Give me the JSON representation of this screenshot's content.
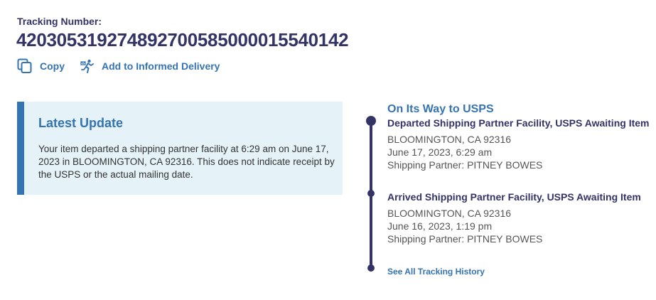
{
  "tracking": {
    "label": "Tracking Number:",
    "number": "420305319274892700585000015540142"
  },
  "actions": {
    "copy_label": "Copy",
    "informed_delivery_label": "Add to Informed Delivery"
  },
  "latest_update": {
    "title": "Latest Update",
    "text": "Your item departed a shipping partner facility at 6:29 am on June 17, 2023 in BLOOMINGTON, CA 92316. This does not indicate receipt by the USPS or the actual mailing date."
  },
  "timeline": {
    "status": "On Its Way to USPS",
    "events": [
      {
        "title": "Departed Shipping Partner Facility, USPS Awaiting Item",
        "location": "BLOOMINGTON, CA 92316",
        "datetime": "June 17, 2023, 6:29 am",
        "partner": "Shipping Partner: PITNEY BOWES"
      },
      {
        "title": "Arrived Shipping Partner Facility, USPS Awaiting Item",
        "location": "BLOOMINGTON, CA 92316",
        "datetime": "June 16, 2023, 1:19 pm",
        "partner": "Shipping Partner: PITNEY BOWES"
      }
    ],
    "history_link": "See All Tracking History"
  },
  "colors": {
    "primary_navy": "#333366",
    "link_blue": "#3573b1",
    "update_background": "#e5f3f8"
  },
  "icons": {
    "copy": "copy-icon",
    "informed_delivery": "running-mail-carrier-icon"
  }
}
